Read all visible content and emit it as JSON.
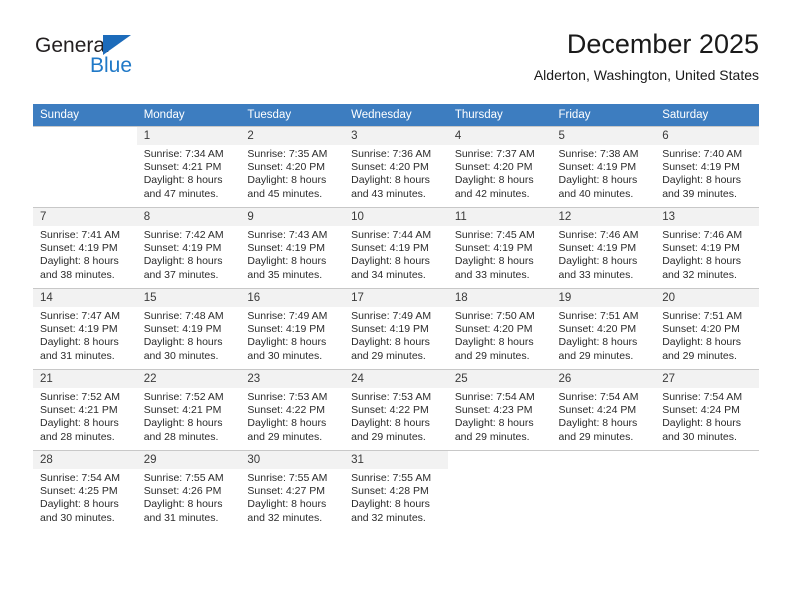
{
  "brand": {
    "word_one": "General",
    "word_two": "Blue",
    "triangle_icon": "triangle-icon",
    "accent_color": "#2079c7"
  },
  "header": {
    "month_title": "December 2025",
    "location": "Alderton, Washington, United States"
  },
  "calendar": {
    "header_bg": "#3d7dc0",
    "daynum_bg": "#f2f2f2",
    "weekday_headers": [
      "Sunday",
      "Monday",
      "Tuesday",
      "Wednesday",
      "Thursday",
      "Friday",
      "Saturday"
    ],
    "weeks": [
      [
        {
          "blank": true
        },
        {
          "day": "1",
          "sunrise": "Sunrise: 7:34 AM",
          "sunset": "Sunset: 4:21 PM",
          "daylight_line1": "Daylight: 8 hours",
          "daylight_line2": "and 47 minutes."
        },
        {
          "day": "2",
          "sunrise": "Sunrise: 7:35 AM",
          "sunset": "Sunset: 4:20 PM",
          "daylight_line1": "Daylight: 8 hours",
          "daylight_line2": "and 45 minutes."
        },
        {
          "day": "3",
          "sunrise": "Sunrise: 7:36 AM",
          "sunset": "Sunset: 4:20 PM",
          "daylight_line1": "Daylight: 8 hours",
          "daylight_line2": "and 43 minutes."
        },
        {
          "day": "4",
          "sunrise": "Sunrise: 7:37 AM",
          "sunset": "Sunset: 4:20 PM",
          "daylight_line1": "Daylight: 8 hours",
          "daylight_line2": "and 42 minutes."
        },
        {
          "day": "5",
          "sunrise": "Sunrise: 7:38 AM",
          "sunset": "Sunset: 4:19 PM",
          "daylight_line1": "Daylight: 8 hours",
          "daylight_line2": "and 40 minutes."
        },
        {
          "day": "6",
          "sunrise": "Sunrise: 7:40 AM",
          "sunset": "Sunset: 4:19 PM",
          "daylight_line1": "Daylight: 8 hours",
          "daylight_line2": "and 39 minutes."
        }
      ],
      [
        {
          "day": "7",
          "sunrise": "Sunrise: 7:41 AM",
          "sunset": "Sunset: 4:19 PM",
          "daylight_line1": "Daylight: 8 hours",
          "daylight_line2": "and 38 minutes."
        },
        {
          "day": "8",
          "sunrise": "Sunrise: 7:42 AM",
          "sunset": "Sunset: 4:19 PM",
          "daylight_line1": "Daylight: 8 hours",
          "daylight_line2": "and 37 minutes."
        },
        {
          "day": "9",
          "sunrise": "Sunrise: 7:43 AM",
          "sunset": "Sunset: 4:19 PM",
          "daylight_line1": "Daylight: 8 hours",
          "daylight_line2": "and 35 minutes."
        },
        {
          "day": "10",
          "sunrise": "Sunrise: 7:44 AM",
          "sunset": "Sunset: 4:19 PM",
          "daylight_line1": "Daylight: 8 hours",
          "daylight_line2": "and 34 minutes."
        },
        {
          "day": "11",
          "sunrise": "Sunrise: 7:45 AM",
          "sunset": "Sunset: 4:19 PM",
          "daylight_line1": "Daylight: 8 hours",
          "daylight_line2": "and 33 minutes."
        },
        {
          "day": "12",
          "sunrise": "Sunrise: 7:46 AM",
          "sunset": "Sunset: 4:19 PM",
          "daylight_line1": "Daylight: 8 hours",
          "daylight_line2": "and 33 minutes."
        },
        {
          "day": "13",
          "sunrise": "Sunrise: 7:46 AM",
          "sunset": "Sunset: 4:19 PM",
          "daylight_line1": "Daylight: 8 hours",
          "daylight_line2": "and 32 minutes."
        }
      ],
      [
        {
          "day": "14",
          "sunrise": "Sunrise: 7:47 AM",
          "sunset": "Sunset: 4:19 PM",
          "daylight_line1": "Daylight: 8 hours",
          "daylight_line2": "and 31 minutes."
        },
        {
          "day": "15",
          "sunrise": "Sunrise: 7:48 AM",
          "sunset": "Sunset: 4:19 PM",
          "daylight_line1": "Daylight: 8 hours",
          "daylight_line2": "and 30 minutes."
        },
        {
          "day": "16",
          "sunrise": "Sunrise: 7:49 AM",
          "sunset": "Sunset: 4:19 PM",
          "daylight_line1": "Daylight: 8 hours",
          "daylight_line2": "and 30 minutes."
        },
        {
          "day": "17",
          "sunrise": "Sunrise: 7:49 AM",
          "sunset": "Sunset: 4:19 PM",
          "daylight_line1": "Daylight: 8 hours",
          "daylight_line2": "and 29 minutes."
        },
        {
          "day": "18",
          "sunrise": "Sunrise: 7:50 AM",
          "sunset": "Sunset: 4:20 PM",
          "daylight_line1": "Daylight: 8 hours",
          "daylight_line2": "and 29 minutes."
        },
        {
          "day": "19",
          "sunrise": "Sunrise: 7:51 AM",
          "sunset": "Sunset: 4:20 PM",
          "daylight_line1": "Daylight: 8 hours",
          "daylight_line2": "and 29 minutes."
        },
        {
          "day": "20",
          "sunrise": "Sunrise: 7:51 AM",
          "sunset": "Sunset: 4:20 PM",
          "daylight_line1": "Daylight: 8 hours",
          "daylight_line2": "and 29 minutes."
        }
      ],
      [
        {
          "day": "21",
          "sunrise": "Sunrise: 7:52 AM",
          "sunset": "Sunset: 4:21 PM",
          "daylight_line1": "Daylight: 8 hours",
          "daylight_line2": "and 28 minutes."
        },
        {
          "day": "22",
          "sunrise": "Sunrise: 7:52 AM",
          "sunset": "Sunset: 4:21 PM",
          "daylight_line1": "Daylight: 8 hours",
          "daylight_line2": "and 28 minutes."
        },
        {
          "day": "23",
          "sunrise": "Sunrise: 7:53 AM",
          "sunset": "Sunset: 4:22 PM",
          "daylight_line1": "Daylight: 8 hours",
          "daylight_line2": "and 29 minutes."
        },
        {
          "day": "24",
          "sunrise": "Sunrise: 7:53 AM",
          "sunset": "Sunset: 4:22 PM",
          "daylight_line1": "Daylight: 8 hours",
          "daylight_line2": "and 29 minutes."
        },
        {
          "day": "25",
          "sunrise": "Sunrise: 7:54 AM",
          "sunset": "Sunset: 4:23 PM",
          "daylight_line1": "Daylight: 8 hours",
          "daylight_line2": "and 29 minutes."
        },
        {
          "day": "26",
          "sunrise": "Sunrise: 7:54 AM",
          "sunset": "Sunset: 4:24 PM",
          "daylight_line1": "Daylight: 8 hours",
          "daylight_line2": "and 29 minutes."
        },
        {
          "day": "27",
          "sunrise": "Sunrise: 7:54 AM",
          "sunset": "Sunset: 4:24 PM",
          "daylight_line1": "Daylight: 8 hours",
          "daylight_line2": "and 30 minutes."
        }
      ],
      [
        {
          "day": "28",
          "sunrise": "Sunrise: 7:54 AM",
          "sunset": "Sunset: 4:25 PM",
          "daylight_line1": "Daylight: 8 hours",
          "daylight_line2": "and 30 minutes."
        },
        {
          "day": "29",
          "sunrise": "Sunrise: 7:55 AM",
          "sunset": "Sunset: 4:26 PM",
          "daylight_line1": "Daylight: 8 hours",
          "daylight_line2": "and 31 minutes."
        },
        {
          "day": "30",
          "sunrise": "Sunrise: 7:55 AM",
          "sunset": "Sunset: 4:27 PM",
          "daylight_line1": "Daylight: 8 hours",
          "daylight_line2": "and 32 minutes."
        },
        {
          "day": "31",
          "sunrise": "Sunrise: 7:55 AM",
          "sunset": "Sunset: 4:28 PM",
          "daylight_line1": "Daylight: 8 hours",
          "daylight_line2": "and 32 minutes."
        },
        {
          "blank": true
        },
        {
          "blank": true
        },
        {
          "blank": true
        }
      ]
    ]
  }
}
